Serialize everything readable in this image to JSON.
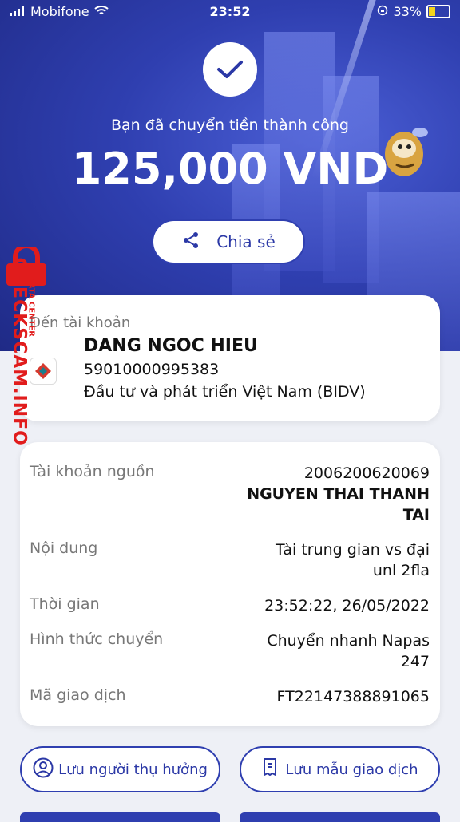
{
  "status_bar": {
    "carrier": "Mobifone",
    "time": "23:52",
    "battery": "33%"
  },
  "success": {
    "message": "Bạn đã chuyển tiền thành công",
    "amount": "125,000 VND",
    "share_label": "Chia sẻ"
  },
  "recipient": {
    "label": "Đến tài khoản",
    "name": "DANG NGOC HIEU",
    "account": "59010000995383",
    "bank": "Đầu tư và phát triển Việt Nam (BIDV)"
  },
  "details": [
    {
      "label": "Tài khoản nguồn",
      "value": "2006200620069",
      "value2": "NGUYEN THAI THANH",
      "value3": "TAI"
    },
    {
      "label": "Nội dung",
      "value": "Tài trung gian vs đại",
      "value2": "unl 2fla"
    },
    {
      "label": "Thời gian",
      "value": "23:52:22, 26/05/2022"
    },
    {
      "label": "Hình thức chuyển",
      "value": "Chuyển nhanh Napas",
      "value2": "247"
    },
    {
      "label": "Mã giao dịch",
      "value": "FT22147388891065"
    }
  ],
  "actions": {
    "save_recipient": "Lưu người thụ hưởng",
    "save_template": "Lưu mẫu giao dịch"
  },
  "watermark": {
    "main": "CHECKSCAM.INFO",
    "sub": "DATA CENTER"
  },
  "colors": {
    "primary": "#2f3fb0",
    "hero_dark": "#1f2a86",
    "watermark": "#e11c1c"
  }
}
